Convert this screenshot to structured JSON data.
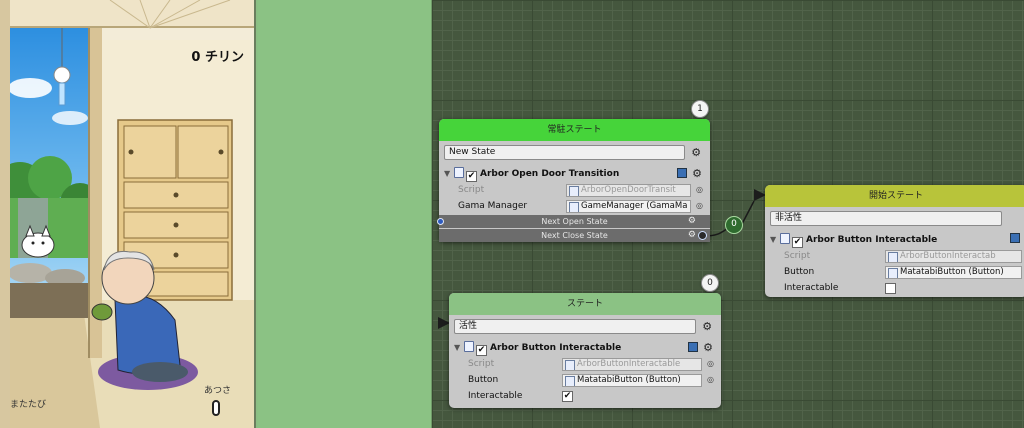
{
  "game": {
    "currency": "0 チリン",
    "matatabi_label": "またたび",
    "heat_label": "あつさ"
  },
  "nodes": {
    "resident": {
      "badge": "1",
      "title": "常駐ステート",
      "state_name": "New State",
      "behaviour": "Arbor Open Door Transition",
      "props": [
        {
          "name": "Script",
          "value": "ArborOpenDoorTransit"
        },
        {
          "name": "Gama Manager",
          "value": "GameManager (GamaMa"
        }
      ],
      "links": [
        "Next Open State",
        "Next Close State"
      ]
    },
    "start": {
      "title": "開始ステート",
      "state_name": "非活性",
      "behaviour": "Arbor Button Interactable",
      "props": [
        {
          "name": "Script",
          "value": "ArborButtonInteractab"
        },
        {
          "name": "Button",
          "value": "MatatabiButton (Button)"
        },
        {
          "name": "Interactable",
          "value": ""
        }
      ]
    },
    "state": {
      "badge": "0",
      "title": "ステート",
      "state_name": "活性",
      "behaviour": "Arbor Button Interactable",
      "props": [
        {
          "name": "Script",
          "value": "ArborButtonInteractable"
        },
        {
          "name": "Button",
          "value": "MatatabiButton (Button)"
        },
        {
          "name": "Interactable",
          "value": "✔"
        }
      ]
    }
  },
  "connection": {
    "badge": "0"
  },
  "colors": {
    "resident_header": "#46d43a",
    "start_header": "#b8c43a",
    "state_header": "#8bc284",
    "graph_bg": "#45573e"
  }
}
